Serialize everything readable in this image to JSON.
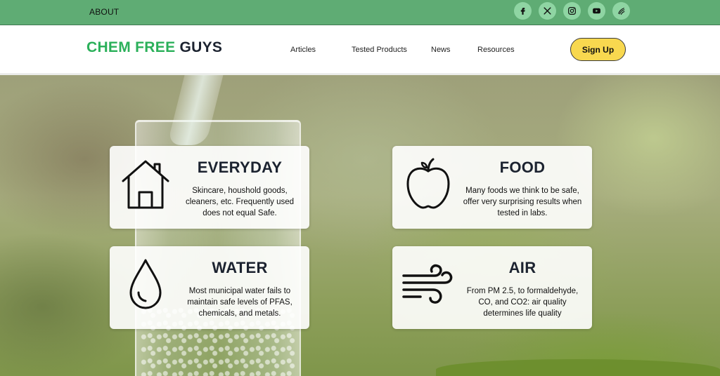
{
  "topbar": {
    "about_label": "ABOUT",
    "socials": [
      {
        "icon": "facebook-icon",
        "glyph": "f"
      },
      {
        "icon": "x-twitter-icon",
        "glyph": "𝕏"
      },
      {
        "icon": "instagram-icon",
        "glyph": ""
      },
      {
        "icon": "youtube-icon",
        "glyph": ""
      },
      {
        "icon": "substack-icon",
        "glyph": ""
      }
    ],
    "background_color": "#5fac74"
  },
  "header": {
    "logo_part1": "CHEM FREE",
    "logo_part2": "GUYS",
    "nav": {
      "articles": "Articles",
      "tested_products": "Tested Products",
      "news": "News",
      "resources": "Resources"
    },
    "signup_label": "Sign Up",
    "signup_color": "#f8d84f"
  },
  "cards": {
    "everyday": {
      "icon": "house-icon",
      "title": "EVERYDAY",
      "description": "Skincare, houshold goods, cleaners, etc. Frequently used does not equal Safe."
    },
    "food": {
      "icon": "apple-icon",
      "title": "FOOD",
      "description": "Many foods we think to be safe, offer very surprising results when tested in labs."
    },
    "water": {
      "icon": "water-drop-icon",
      "title": "WATER",
      "description": "Most municipal water fails to maintain safe levels of PFAS, chemicals, and metals."
    },
    "air": {
      "icon": "wind-icon",
      "title": "AIR",
      "description": "From PM 2.5, to formaldehyde, CO, and CO2: air quality determines life quality"
    }
  }
}
